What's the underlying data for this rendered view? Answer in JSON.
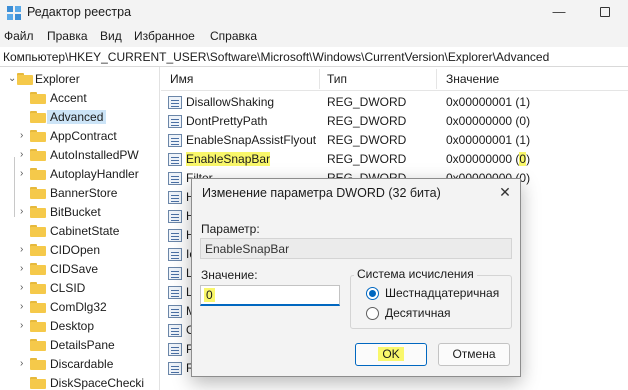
{
  "window": {
    "title": "Редактор реестра",
    "minimize_glyph": "—",
    "maximize_icon": "maximize-icon"
  },
  "menu": [
    "Файл",
    "Правка",
    "Вид",
    "Избранное",
    "Справка"
  ],
  "address": "Компьютер\\HKEY_CURRENT_USER\\Software\\Microsoft\\Windows\\CurrentVersion\\Explorer\\Advanced",
  "tree": {
    "root": "Explorer",
    "items": [
      "Accent",
      "Advanced",
      "AppContract",
      "AutoInstalledPW",
      "AutoplayHandler",
      "BannerStore",
      "BitBucket",
      "CabinetState",
      "CIDOpen",
      "CIDSave",
      "CLSID",
      "ComDlg32",
      "Desktop",
      "DetailsPane",
      "Discardable",
      "DiskSpaceChecki"
    ],
    "selected": "Advanced"
  },
  "list": {
    "headers": {
      "name": "Имя",
      "type": "Тип",
      "value": "Значение"
    },
    "rows": [
      {
        "name": "DisallowShaking",
        "type": "REG_DWORD",
        "value": "0x00000001 (1)"
      },
      {
        "name": "DontPrettyPath",
        "type": "REG_DWORD",
        "value": "0x00000000 (0)"
      },
      {
        "name": "EnableSnapAssistFlyout",
        "type": "REG_DWORD",
        "value": "0x00000001 (1)"
      },
      {
        "name": "EnableSnapBar",
        "type": "REG_DWORD",
        "value_prefix": "0x00000000 (",
        "value_hl": "0",
        "value_suffix": ")"
      },
      {
        "name": "Filter",
        "type": "REG_DWORD",
        "value": "0x00000000 (0)"
      }
    ],
    "partial_names": [
      "H",
      "H",
      "H",
      "Ic",
      "L",
      "L",
      "M",
      "O",
      "P",
      "R"
    ]
  },
  "dialog": {
    "title": "Изменение параметра DWORD (32 бита)",
    "close_glyph": "✕",
    "param_label": "Параметр:",
    "param_name": "EnableSnapBar",
    "value_label": "Значение:",
    "value": "0",
    "base_group": "Система исчисления",
    "base_options": [
      "Шестнадцатеричная",
      "Десятичная"
    ],
    "base_selected": "Шестнадцатеричная",
    "ok": "OK",
    "cancel": "Отмена"
  },
  "colors": {
    "highlight": "#f9f76b",
    "accent": "#0067c0",
    "selection": "#cce4f7"
  }
}
